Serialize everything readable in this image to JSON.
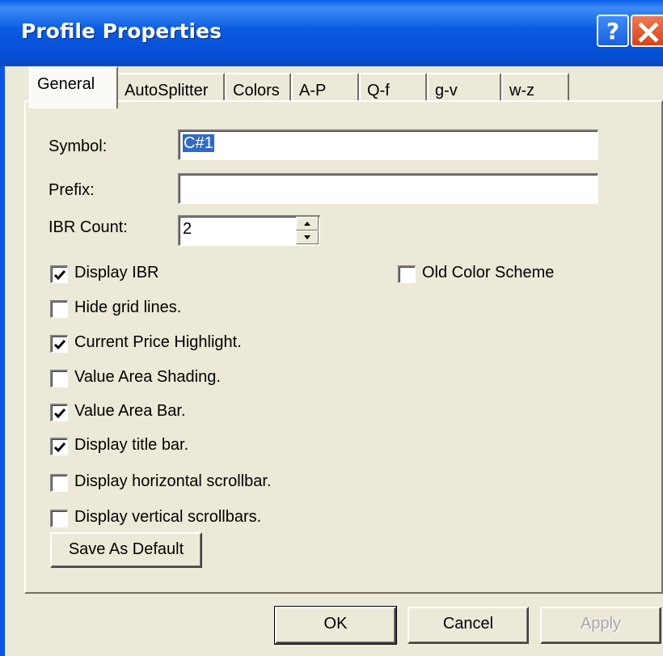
{
  "window": {
    "title": "Profile Properties",
    "help_glyph": "?",
    "close_icon": "close-icon"
  },
  "tabs": [
    {
      "label": "General",
      "active": true
    },
    {
      "label": "AutoSplitter",
      "active": false
    },
    {
      "label": "Colors",
      "active": false
    },
    {
      "label": "A-P",
      "active": false
    },
    {
      "label": "Q-f",
      "active": false
    },
    {
      "label": "g-v",
      "active": false
    },
    {
      "label": "w-z",
      "active": false
    }
  ],
  "form": {
    "symbol_label": "Symbol:",
    "symbol_value": "C#1",
    "prefix_label": "Prefix:",
    "prefix_value": "",
    "ibr_count_label": "IBR Count:",
    "ibr_count_value": "2"
  },
  "checkboxes": [
    {
      "label": "Display IBR",
      "checked": true
    },
    {
      "label": "Old Color Scheme",
      "checked": false
    },
    {
      "label": "Hide grid lines.",
      "checked": false
    },
    {
      "label": "Current Price Highlight.",
      "checked": true
    },
    {
      "label": "Value Area Shading.",
      "checked": false
    },
    {
      "label": "Value Area Bar.",
      "checked": true
    },
    {
      "label": "Display title bar.",
      "checked": true
    },
    {
      "label": "Display horizontal scrollbar.",
      "checked": false
    },
    {
      "label": "Display vertical scrollbars.",
      "checked": false
    }
  ],
  "buttons": {
    "save_default": "Save As Default",
    "ok": "OK",
    "cancel": "Cancel",
    "apply": "Apply"
  },
  "colors": {
    "titlebar": "#0a55e3",
    "dialog_bg": "#ece9d8",
    "selection": "#316ac5"
  }
}
